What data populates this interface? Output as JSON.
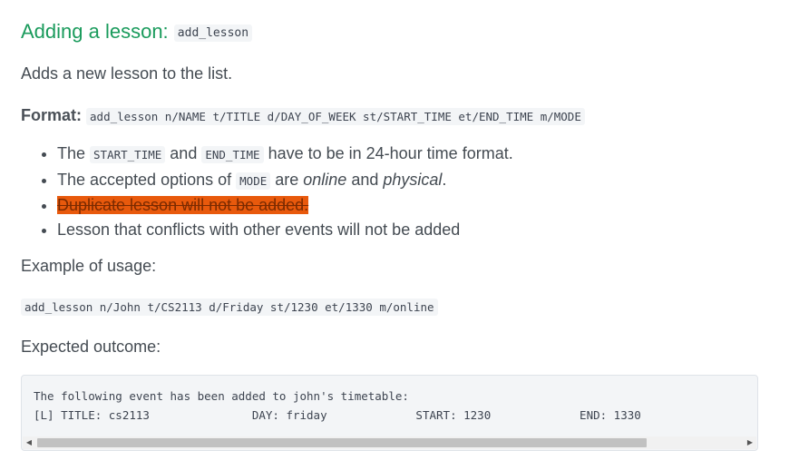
{
  "heading": {
    "text": "Adding a lesson:",
    "code": "add_lesson"
  },
  "description": "Adds a new lesson to the list.",
  "format": {
    "label": "Format:",
    "code": "add_lesson n/NAME t/TITLE d/DAY_OF_WEEK st/START_TIME et/END_TIME m/MODE"
  },
  "bullets": {
    "b1": {
      "pre": "The ",
      "code1": "START_TIME",
      "mid": " and ",
      "code2": "END_TIME",
      "post": " have to be in 24-hour time format."
    },
    "b2": {
      "pre": "The accepted options of ",
      "code": "MODE",
      "mid": " are ",
      "em1": "online",
      "and": " and ",
      "em2": "physical",
      "post": "."
    },
    "b3": "Duplicate lesson will not be added.",
    "b4": "Lesson that conflicts with other events will not be added"
  },
  "example_label": "Example of usage:",
  "example_code": "add_lesson n/John t/CS2113 d/Friday st/1230 et/1330 m/online",
  "outcome_label": "Expected outcome:",
  "outcome_lines": [
    "The following event has been added to john's timetable:",
    "[L] TITLE: cs2113               DAY: friday             START: 1230             END: 1330"
  ],
  "colors": {
    "heading": "#1a9b5c",
    "highlight": "#e8590c"
  }
}
